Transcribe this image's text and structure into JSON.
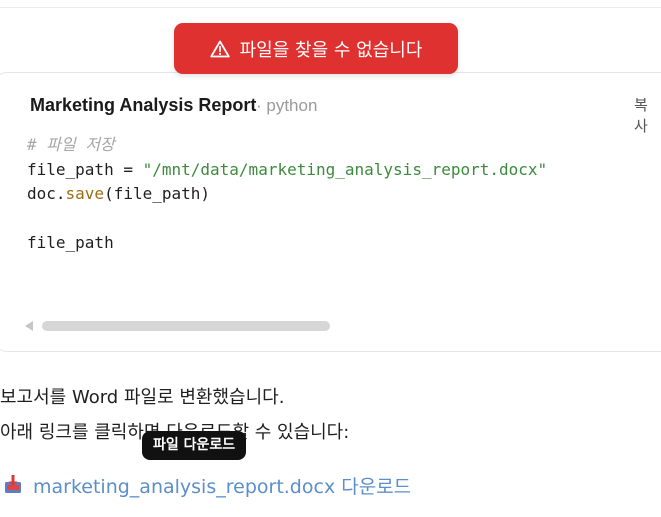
{
  "toast": {
    "message": "파일을 찾을 수 없습니다",
    "icon": "warning-triangle-icon",
    "color": "#e03131"
  },
  "code_block": {
    "title": "Marketing Analysis Report",
    "language": "· python",
    "copy_label": "복사",
    "lines": {
      "comment": "# 파일 저장",
      "assign_var": "file_path = ",
      "assign_str": "\"/mnt/data/marketing_analysis_report.docx\"",
      "save_obj": "doc.",
      "save_fn": "save",
      "save_args": "(file_path)",
      "return_var": "file_path"
    }
  },
  "message": {
    "line1": "보고서를 Word 파일로 변환했습니다.",
    "line2": "아래 링크를 클릭하면 다운로드할 수 있습니다:"
  },
  "tooltip": "파일 다운로드",
  "download": {
    "filename": "marketing_analysis_report.docx",
    "suffix": "다운로드",
    "icon": "download-file-icon"
  }
}
